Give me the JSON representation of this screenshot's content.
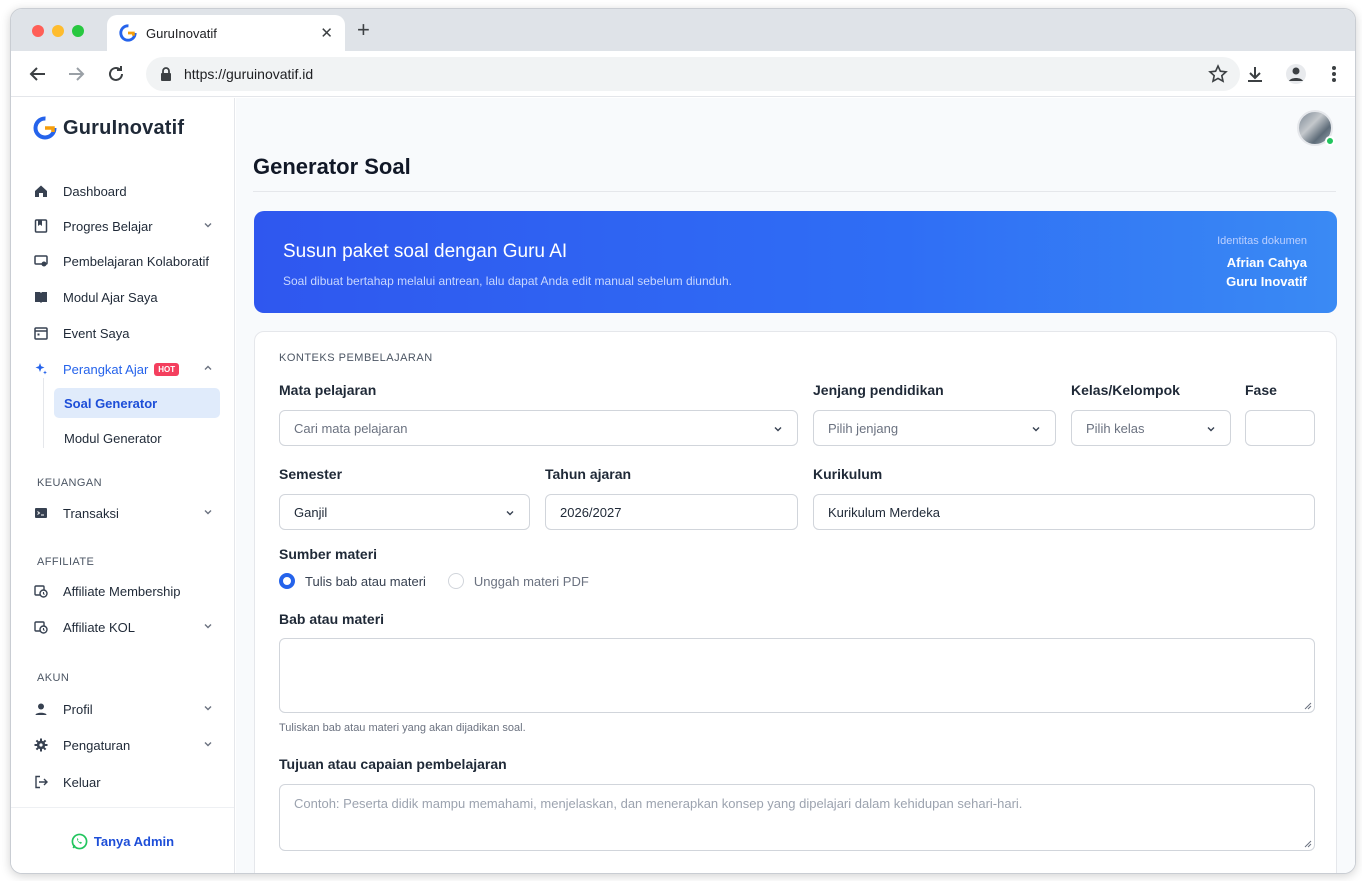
{
  "browser": {
    "tab_title": "GuruInovatif",
    "url": "https://guruinovatif.id"
  },
  "sidebar": {
    "brand": "GuruInovatif",
    "items": [
      {
        "label": "Dashboard",
        "icon": "home-icon"
      },
      {
        "label": "Progres Belajar",
        "icon": "bookmark-icon"
      },
      {
        "label": "Pembelajaran Kolaboratif",
        "icon": "monitor-icon"
      },
      {
        "label": "Modul Ajar Saya",
        "icon": "book-open-icon"
      },
      {
        "label": "Event Saya",
        "icon": "calendar-icon"
      },
      {
        "label": "Perangkat Ajar",
        "icon": "sparkles-icon",
        "badge": "HOT"
      }
    ],
    "sub_items": [
      "Soal Generator",
      "Modul Generator"
    ],
    "sections": {
      "keuangan": "KEUANGAN",
      "affiliate": "AFFILIATE",
      "akun": "AKUN"
    },
    "keuangan_items": [
      {
        "label": "Transaksi",
        "icon": "terminal-icon"
      }
    ],
    "affiliate_items": [
      {
        "label": "Affiliate Membership",
        "icon": "affiliate-icon"
      },
      {
        "label": "Affiliate KOL",
        "icon": "affiliate-icon"
      }
    ],
    "akun_items": [
      {
        "label": "Profil",
        "icon": "user-icon"
      },
      {
        "label": "Pengaturan",
        "icon": "gear-icon"
      },
      {
        "label": "Keluar",
        "icon": "logout-icon"
      }
    ],
    "footer": "Tanya Admin"
  },
  "main": {
    "title": "Generator Soal",
    "hero": {
      "title": "Susun paket soal dengan Guru AI",
      "subtitle": "Soal dibuat bertahap melalui antrean, lalu dapat Anda edit manual sebelum diunduh.",
      "identity_label": "Identitas dokumen",
      "name": "Afrian Cahya",
      "org": "Guru Inovatif"
    },
    "form": {
      "section": "KONTEKS PEMBELAJARAN",
      "mata_pelajaran": {
        "label": "Mata pelajaran",
        "placeholder": "Cari mata pelajaran"
      },
      "jenjang": {
        "label": "Jenjang pendidikan",
        "placeholder": "Pilih jenjang"
      },
      "kelas": {
        "label": "Kelas/Kelompok",
        "placeholder": "Pilih kelas"
      },
      "fase": {
        "label": "Fase",
        "value": ""
      },
      "semester": {
        "label": "Semester",
        "value": "Ganjil"
      },
      "tahun": {
        "label": "Tahun ajaran",
        "value": "2026/2027"
      },
      "kurikulum": {
        "label": "Kurikulum",
        "value": "Kurikulum Merdeka"
      },
      "sumber": {
        "label": "Sumber materi",
        "option1": "Tulis bab atau materi",
        "option2": "Unggah materi PDF",
        "selected": "Tulis bab atau materi"
      },
      "bab": {
        "label": "Bab atau materi",
        "help": "Tuliskan bab atau materi yang akan dijadikan soal."
      },
      "tujuan": {
        "label": "Tujuan atau capaian pembelajaran",
        "placeholder": "Contoh: Peserta didik mampu memahami, menjelaskan, dan menerapkan konsep yang dipelajari dalam kehidupan sehari-hari."
      }
    }
  },
  "colors": {
    "accent": "#2563eb",
    "hot": "#f43f5e",
    "online": "#22c55e"
  }
}
